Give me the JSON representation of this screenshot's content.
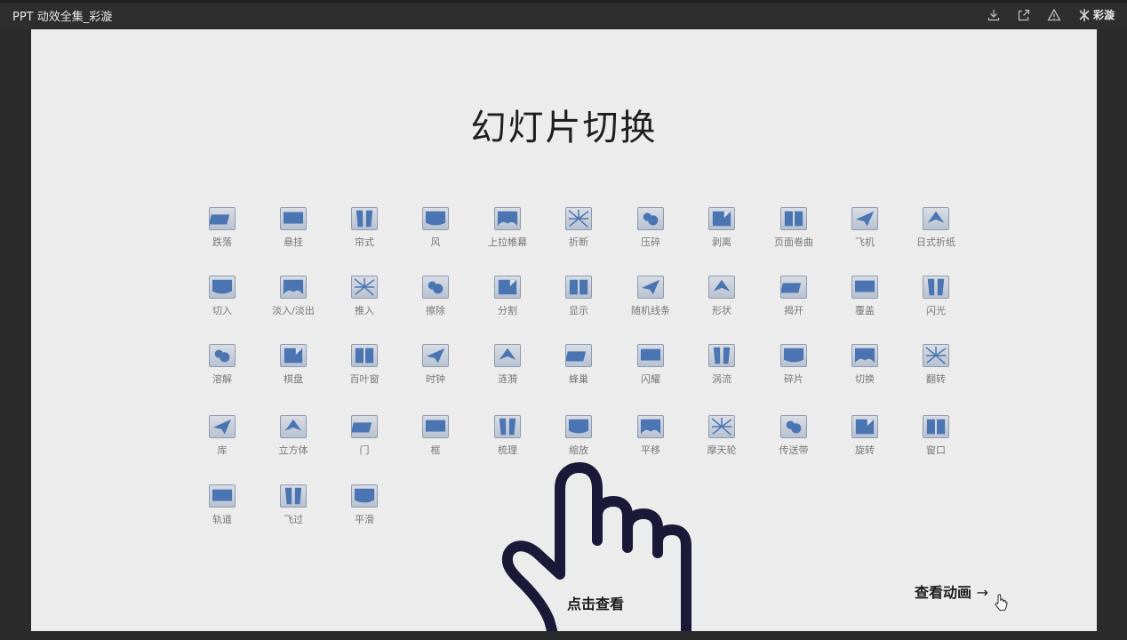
{
  "window": {
    "title": "PPT 动效全集_彩漩",
    "brand_label": "彩漩"
  },
  "slide": {
    "title": "幻灯片切换",
    "press_hint": "点击查看",
    "view_animation": "查看动画",
    "view_animation_arrow": "→"
  },
  "transitions": [
    [
      "跌落",
      "悬挂",
      "帘式",
      "风",
      "上拉帷幕",
      "折断",
      "压碎",
      "剥离",
      "页面卷曲",
      "飞机",
      "日式折纸"
    ],
    [
      "切入",
      "淡入/淡出",
      "推入",
      "擦除",
      "分割",
      "显示",
      "随机线条",
      "形状",
      "揭开",
      "覆盖",
      "闪光"
    ],
    [
      "溶解",
      "棋盘",
      "百叶窗",
      "时钟",
      "涟漪",
      "蜂巢",
      "闪耀",
      "涡流",
      "碎片",
      "切换",
      "翻转"
    ],
    [
      "库",
      "立方体",
      "门",
      "框",
      "梳理",
      "缩放",
      "平移",
      "摩天轮",
      "传送带",
      "旋转",
      "窗口"
    ],
    [
      "轨道",
      "飞过",
      "平滑"
    ]
  ],
  "colors": {
    "slide_bg": "#ececec",
    "icon_blue": "#4a74b2",
    "label_gray": "#777777",
    "hand_stroke": "#1b1838"
  },
  "icons": {
    "download": "download-icon",
    "open_external": "open-external-icon",
    "report": "warning-icon",
    "brand": "brand-logo-icon"
  }
}
